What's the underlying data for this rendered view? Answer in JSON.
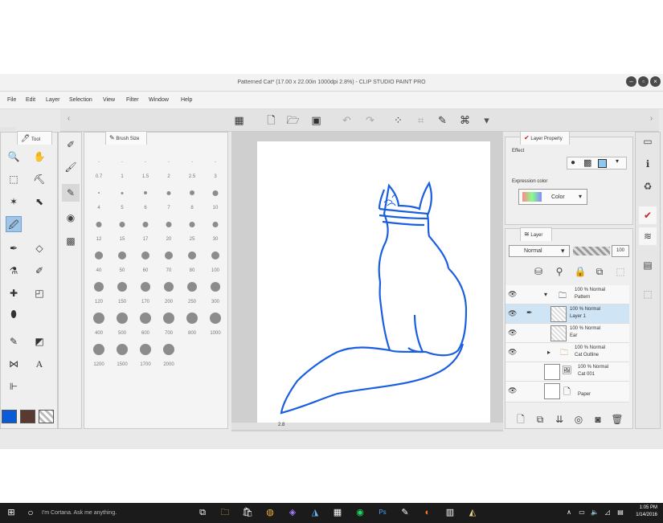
{
  "window": {
    "title": "Patterned Cat* (17.00 x 22.00in 1000dpi 2.8%) - CLIP STUDIO PAINT PRO"
  },
  "menu": [
    "File",
    "Edit",
    "Layer",
    "Selection",
    "View",
    "Filter",
    "Window",
    "Help"
  ],
  "tool_panel": {
    "tab_label": "Tool"
  },
  "brush_size_panel": {
    "tab_label": "Brush Size",
    "rows": [
      [
        "0.7",
        "1",
        "1.5",
        "2",
        "2.5",
        "3"
      ],
      [
        "4",
        "5",
        "6",
        "7",
        "8",
        "10"
      ],
      [
        "12",
        "15",
        "17",
        "20",
        "25",
        "30"
      ],
      [
        "40",
        "50",
        "60",
        "70",
        "80",
        "100"
      ],
      [
        "120",
        "150",
        "170",
        "200",
        "250",
        "300"
      ],
      [
        "400",
        "500",
        "600",
        "700",
        "800",
        "1000"
      ],
      [
        "1200",
        "1500",
        "1700",
        "2000"
      ]
    ]
  },
  "layer_property": {
    "tab_label": "Layer Property",
    "effect_label": "Effect",
    "expression_color_label": "Expression color",
    "expression_color_value": "Color"
  },
  "layer_panel": {
    "tab_label": "Layer",
    "blend_mode": "Normal",
    "opacity": "100",
    "layers": [
      {
        "line1": "100 % Normal",
        "line2": "Pattern"
      },
      {
        "line1": "100 % Normal",
        "line2": "Layer 1"
      },
      {
        "line1": "100 % Normal",
        "line2": "Ear"
      },
      {
        "line1": "100 % Normal",
        "line2": "Cat Outline"
      },
      {
        "line1": "100 % Normal",
        "line2": "Cat 001"
      },
      {
        "line1": "",
        "line2": "Paper"
      }
    ]
  },
  "canvas": {
    "zoom": "2.8",
    "line_color": "#1a5fe0"
  },
  "colors": {
    "main": "#0a5bd8",
    "sub": "#5a3a30"
  },
  "taskbar": {
    "search_placeholder": "I'm Cortana. Ask me anything.",
    "time": "1:05 PM",
    "date": "1/14/2016"
  }
}
